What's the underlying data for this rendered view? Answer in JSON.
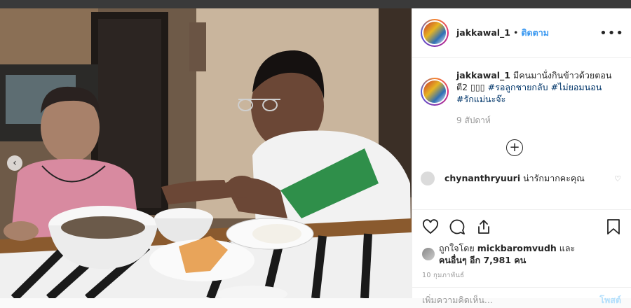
{
  "post": {
    "username": "jakkawal_1",
    "follow_label": "ติดตาม",
    "separator": "•",
    "more_icon": "more-options-icon"
  },
  "caption": {
    "username": "jakkawal_1",
    "text": "มีคนมานั่งกินข้าวด้วยตอนตี2 ▯▯▯",
    "tags": [
      "#รอลูกชายกลับ",
      "#ไม่ยอมนอน",
      "#รักแม่นะจ๊ะ"
    ],
    "time_ago": "9 สัปดาห์"
  },
  "load_more_icon": "plus-circle-icon",
  "comments": [
    {
      "username": "chynanthryuuri",
      "text": "น่ารักมากคะคุณ"
    }
  ],
  "likes": {
    "prefix": "ถูกใจโดย",
    "liker": "mickbaromvudh",
    "and": "และ",
    "others": "คนอื่นๆ อีก 7,981 คน"
  },
  "date": "10 กุมภาพันธ์",
  "comment_box": {
    "placeholder": "เพิ่มความคิดเห็น...",
    "post_label": "โพสต์"
  },
  "colors": {
    "link": "#3897f0",
    "hashtag": "#003569"
  }
}
